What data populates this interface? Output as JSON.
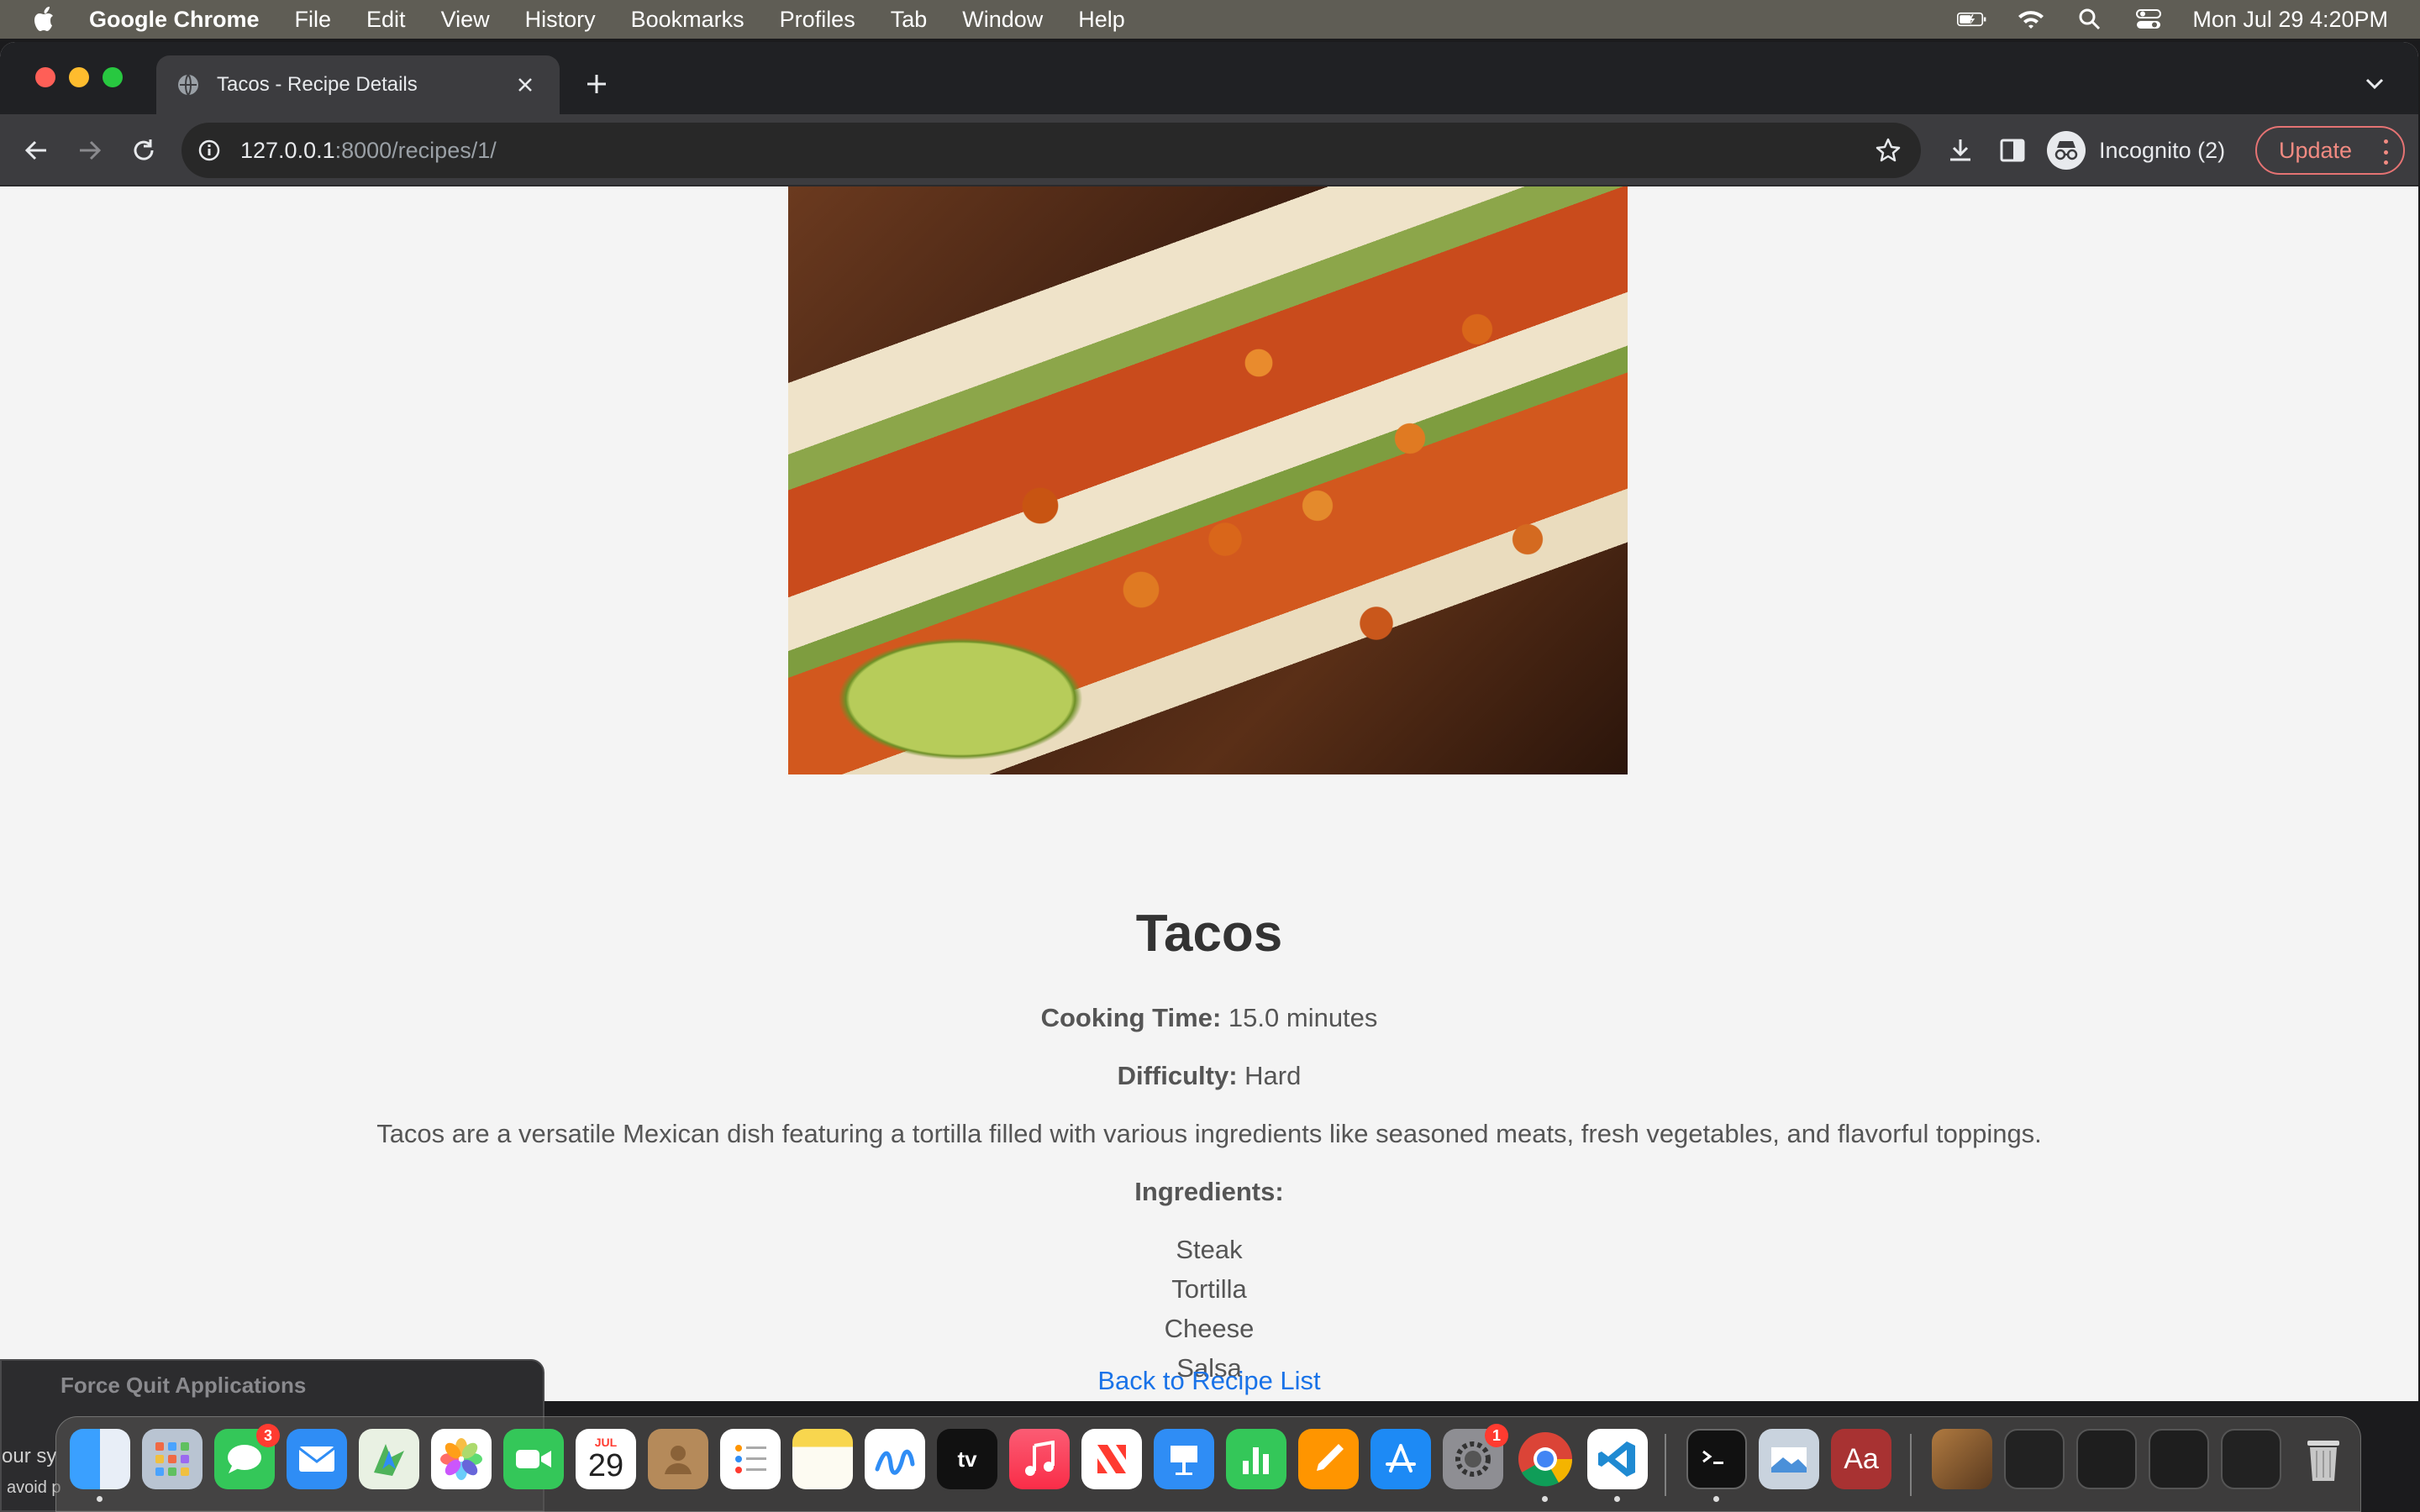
{
  "menubar": {
    "app_name": "Google Chrome",
    "menus": [
      "File",
      "Edit",
      "View",
      "History",
      "Bookmarks",
      "Profiles",
      "Tab",
      "Window",
      "Help"
    ],
    "clock": "Mon Jul 29  4:20PM"
  },
  "browser": {
    "tab_title": "Tacos - Recipe Details",
    "url_host": "127.0.0.1",
    "url_path": ":8000/recipes/1/",
    "incognito_label": "Incognito (2)",
    "update_label": "Update"
  },
  "recipe": {
    "title": "Tacos",
    "cooking_time_label": "Cooking Time:",
    "cooking_time_value": "15.0 minutes",
    "difficulty_label": "Difficulty:",
    "difficulty_value": "Hard",
    "description": "Tacos are a versatile Mexican dish featuring a tortilla filled with various ingredients like seasoned meats, fresh vegetables, and flavorful toppings.",
    "ingredients_label": "Ingredients:",
    "ingredients": [
      "Steak",
      "Tortilla",
      "Cheese",
      "Salsa"
    ],
    "back_link": "Back to Recipe List"
  },
  "force_quit": {
    "title": "Force Quit Applications",
    "text_line_1": "our sy",
    "text_line_2": "avoid p"
  },
  "dock": {
    "calendar_month": "JUL",
    "calendar_day": "29",
    "messages_badge": "3",
    "settings_badge": "1",
    "dictionary_label": "Aa",
    "tv_label": "tv"
  },
  "colors": {
    "link": "#1a73e8",
    "update_accent": "#f28b82",
    "page_bg": "#f4f4f4"
  }
}
